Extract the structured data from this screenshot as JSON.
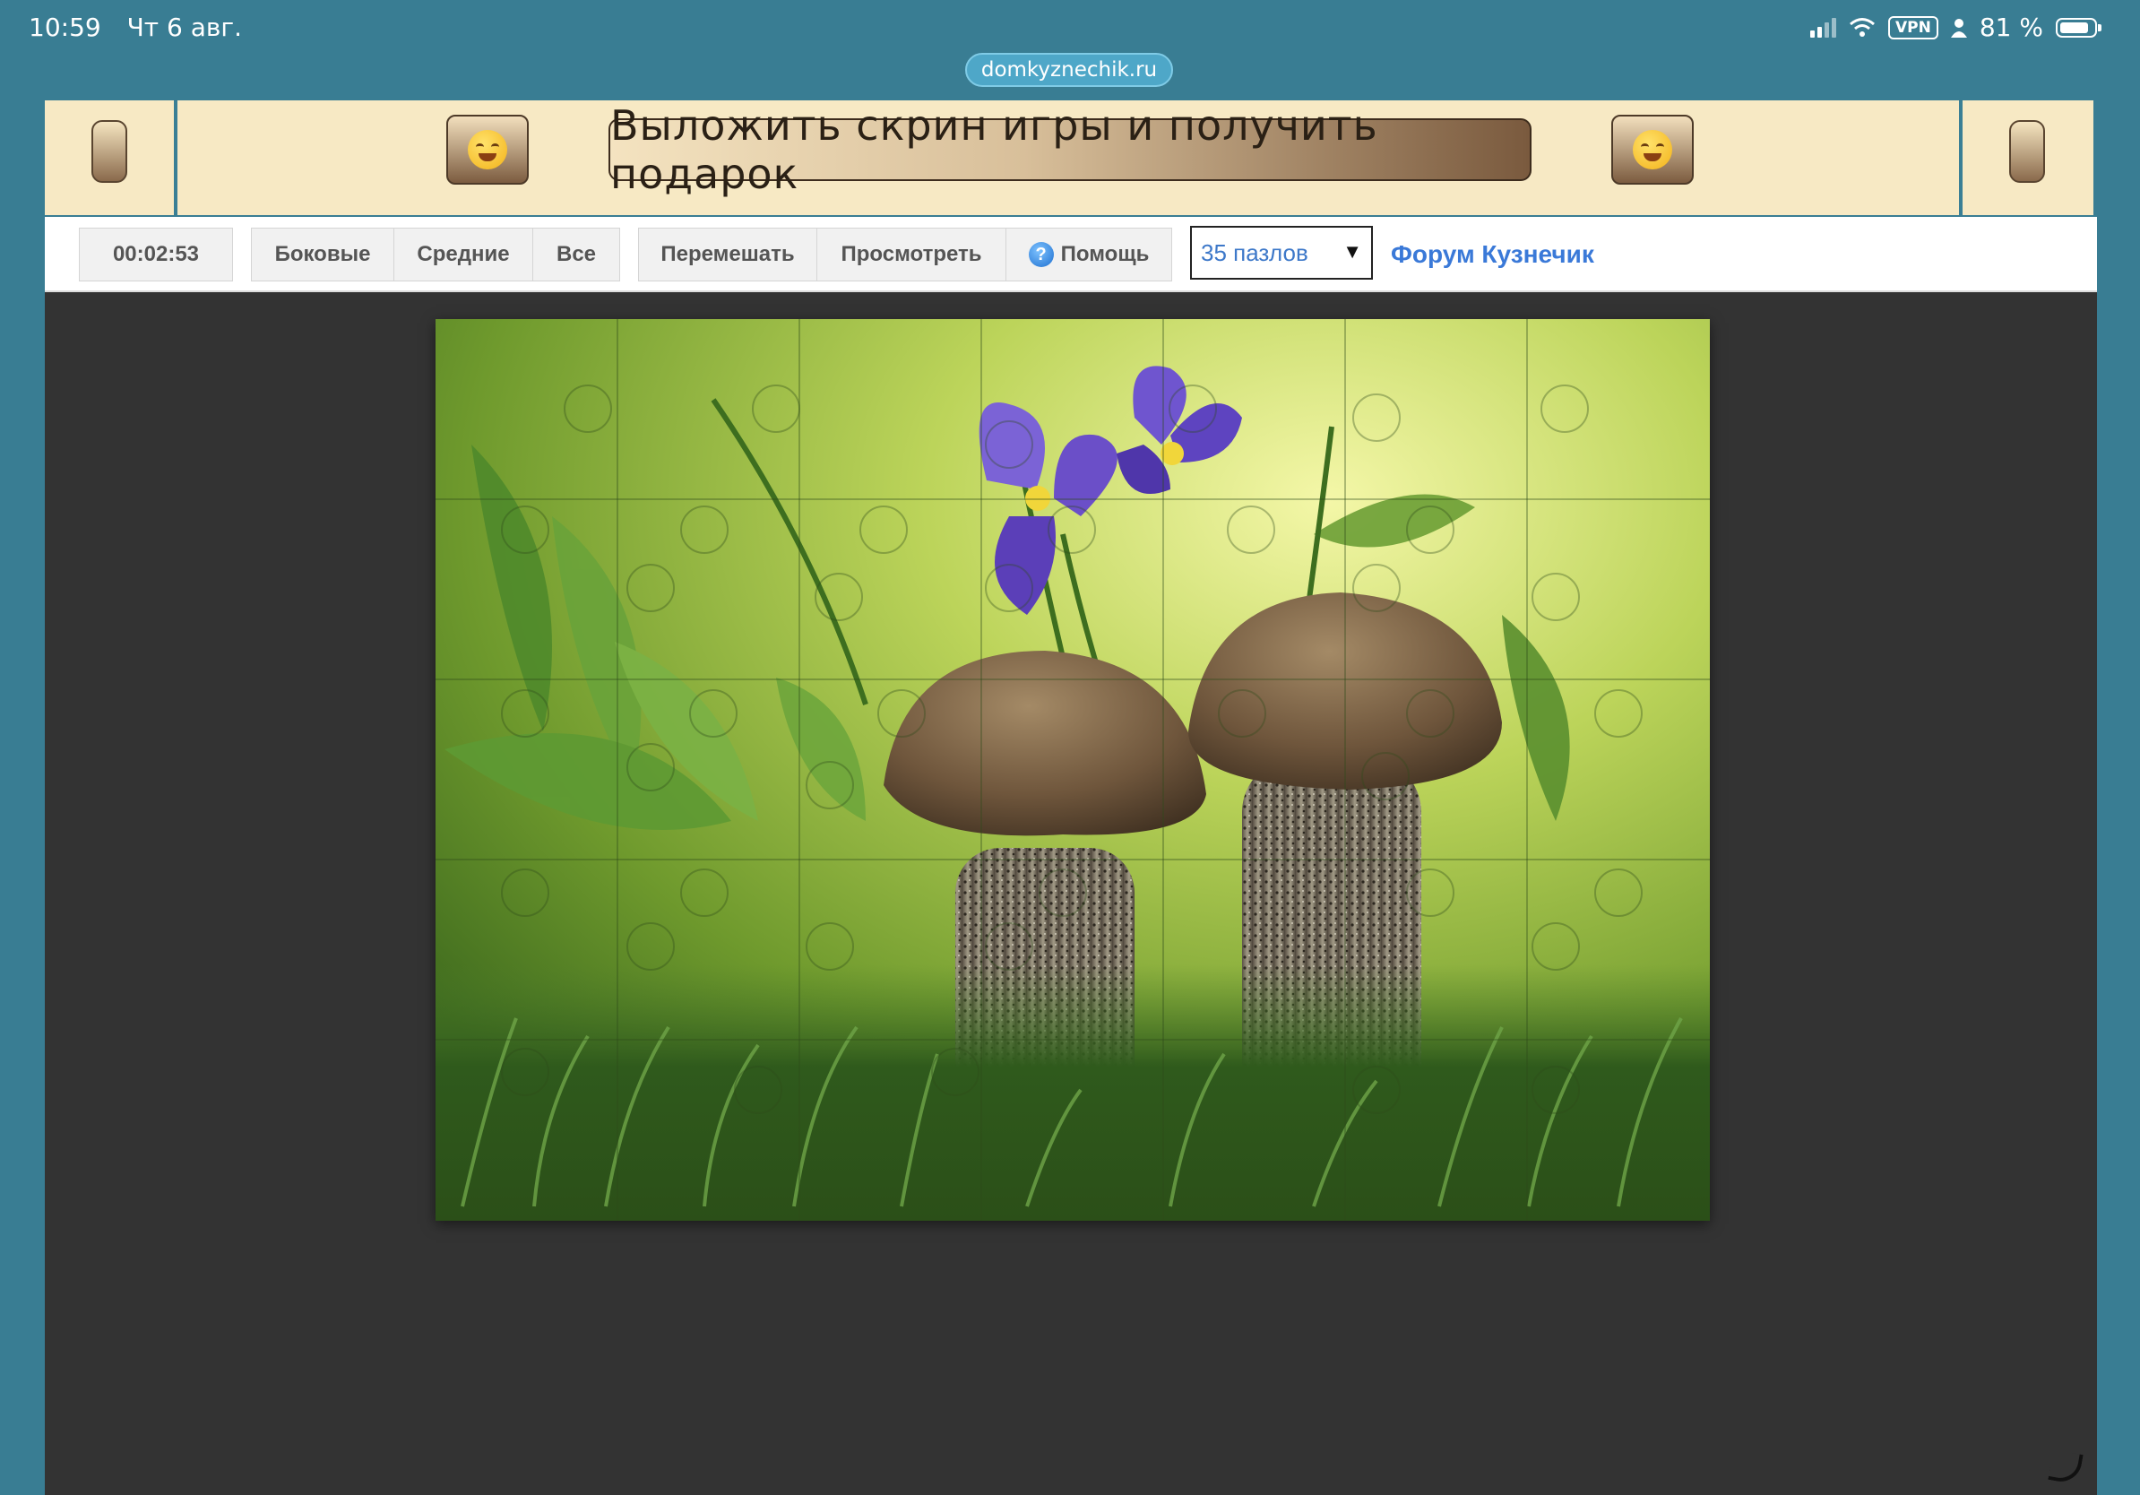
{
  "status_bar": {
    "time": "10:59",
    "date": "Чт 6 авг.",
    "vpn_label": "VPN",
    "battery": "81 %"
  },
  "browser": {
    "url": "domkyznechik.ru"
  },
  "banner": {
    "promo_text": "Выложить скрин игры и получить подарок"
  },
  "toolbar": {
    "timer": "00:02:53",
    "filter_side": "Боковые",
    "filter_middle": "Средние",
    "filter_all": "Все",
    "shuffle": "Перемешать",
    "preview": "Просмотреть",
    "help": "Помощь",
    "pieces_selected": "35 пазлов",
    "forum_link": "Форум Кузнечик"
  },
  "colors": {
    "page_bg": "#397d93",
    "board_bg": "#333333",
    "banner_bg": "#f7e9c4",
    "link": "#3a79d8"
  }
}
